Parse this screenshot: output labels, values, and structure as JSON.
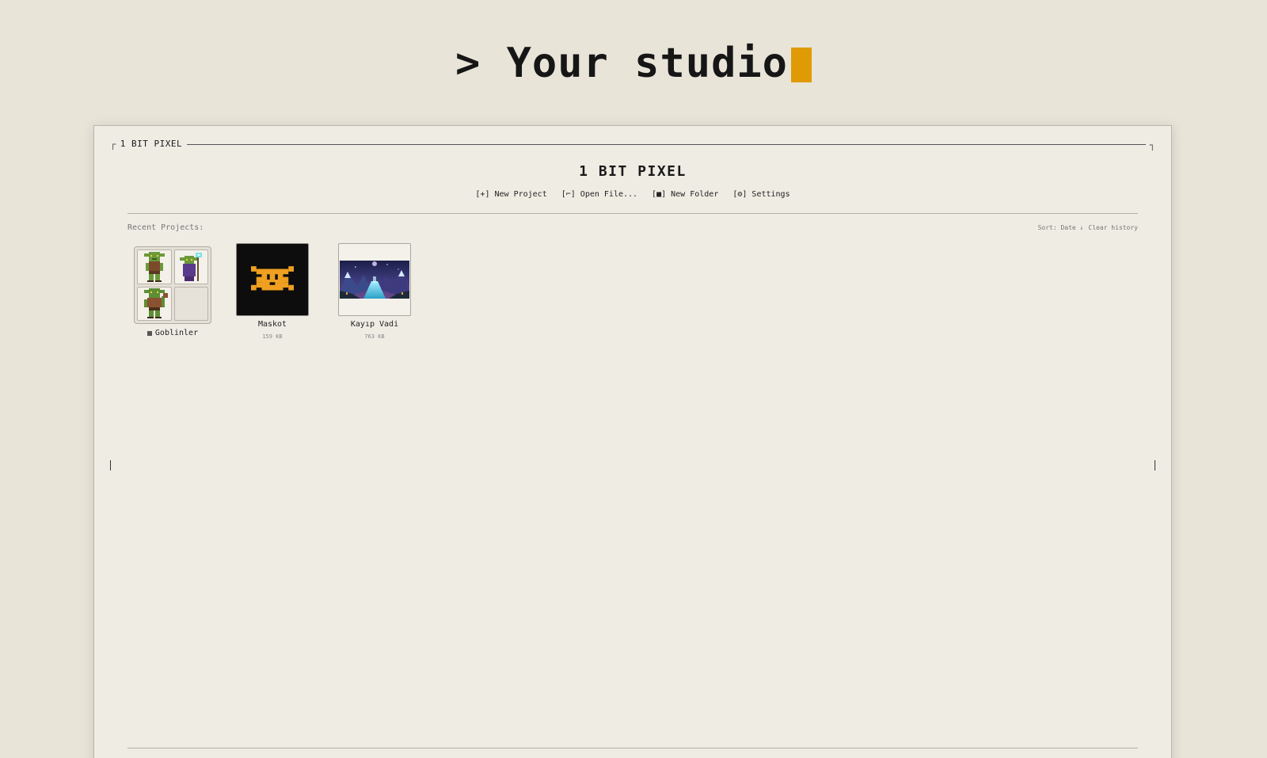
{
  "hero": {
    "prompt": "> Your studio"
  },
  "window": {
    "frame_title": "1 BIT PIXEL",
    "app_title": "1 BIT PIXEL",
    "toolbar": [
      {
        "label": "[+] New Project"
      },
      {
        "label": "[⌐] Open File..."
      },
      {
        "label": "[■] New Folder"
      },
      {
        "label": "[⚙] Settings"
      }
    ],
    "recent_label": "Recent Projects:",
    "sort_label": "Sort: Date ↓",
    "clear_label": "Clear history"
  },
  "projects": {
    "folder": {
      "name": "Goblinler",
      "icon": "folder-icon"
    },
    "items": [
      {
        "name": "Maskot",
        "size": "159 KB"
      },
      {
        "name": "Kayıp Vadi",
        "size": "763 KB"
      }
    ]
  },
  "colors": {
    "background": "#e8e4d8",
    "panel": "#efece4",
    "cursor": "#e09a06",
    "mascot": "#f0a020"
  }
}
